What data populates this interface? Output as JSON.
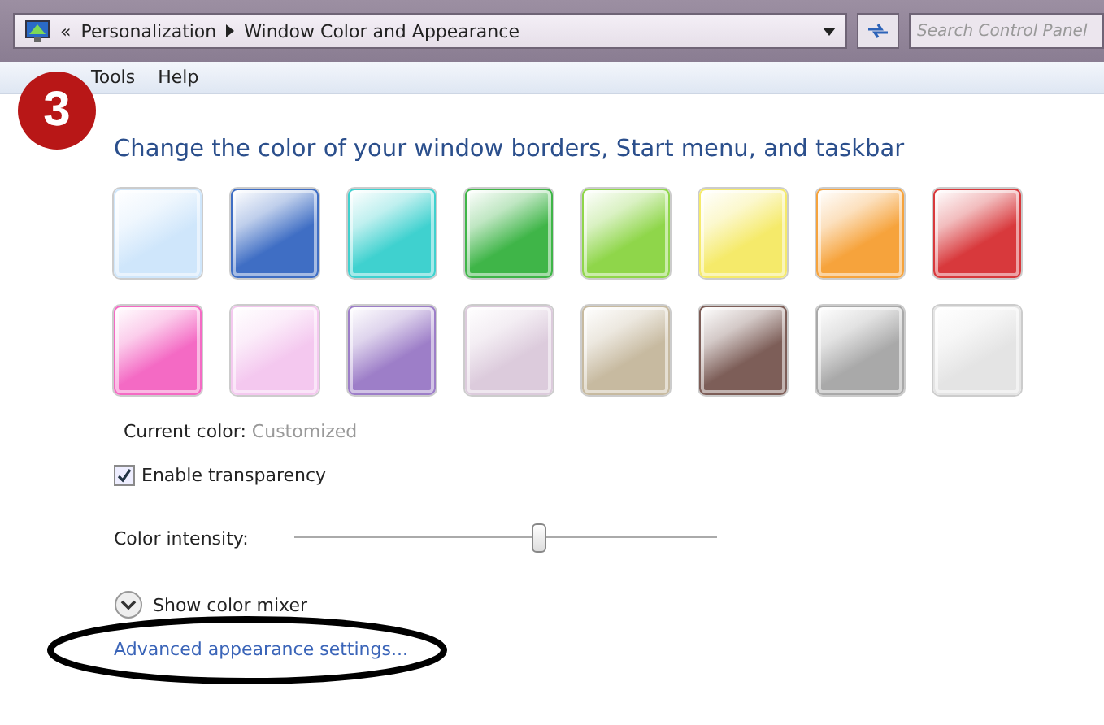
{
  "address_bar": {
    "back_glyph": "«",
    "breadcrumbs": [
      "Personalization",
      "Window Color and Appearance"
    ]
  },
  "search": {
    "placeholder": "Search Control Panel"
  },
  "menu": [
    "Tools",
    "Help"
  ],
  "step_badge": "3",
  "heading": "Change the color of your window borders, Start menu, and taskbar",
  "swatches": [
    {
      "color": "#cfe6fb"
    },
    {
      "color": "#3f6ec4"
    },
    {
      "color": "#3fd1cf"
    },
    {
      "color": "#3fb548"
    },
    {
      "color": "#8fd64a"
    },
    {
      "color": "#f5ea6a"
    },
    {
      "color": "#f6a33c"
    },
    {
      "color": "#d8393c"
    },
    {
      "color": "#f46ac4"
    },
    {
      "color": "#f4c8ef"
    },
    {
      "color": "#9d7ec8"
    },
    {
      "color": "#dccbdc"
    },
    {
      "color": "#c7baa0"
    },
    {
      "color": "#7d5e58"
    },
    {
      "color": "#a9a9a9"
    },
    {
      "color": "#e4e4e4"
    }
  ],
  "current_color": {
    "label": "Current color:",
    "value": "Customized"
  },
  "transparency": {
    "label": "Enable transparency",
    "checked": true
  },
  "intensity": {
    "label": "Color intensity:",
    "level": 0.58
  },
  "mixer": {
    "label": "Show color mixer",
    "expanded": false
  },
  "advanced_link": "Advanced appearance settings..."
}
